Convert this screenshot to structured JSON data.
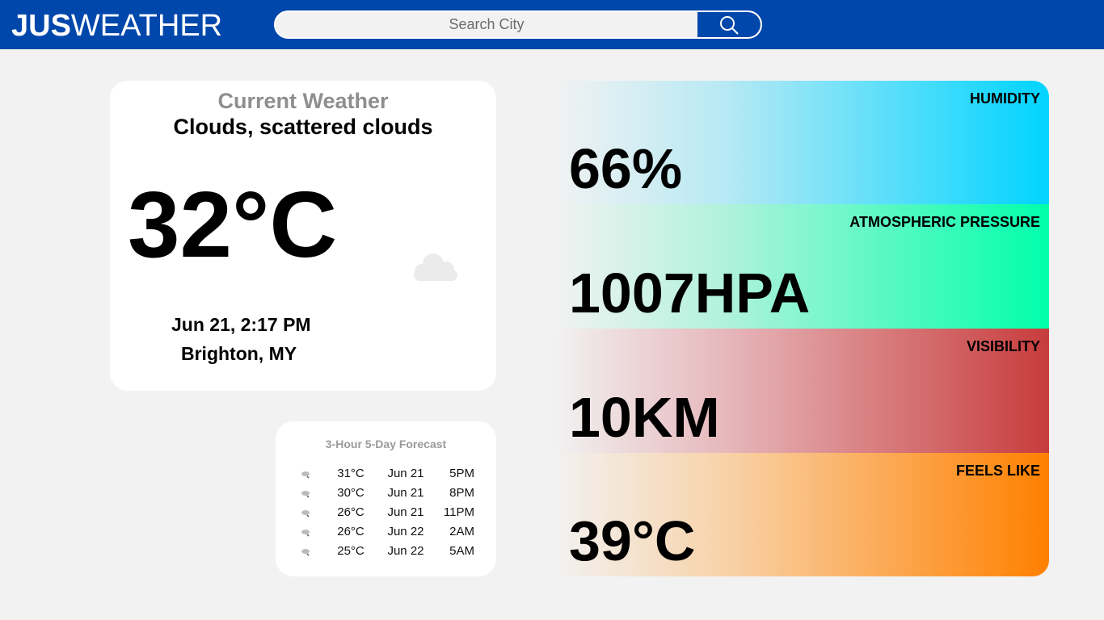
{
  "header": {
    "logo_bold": "JUS",
    "logo_regular": "WEATHER",
    "search_placeholder": "Search City",
    "search_icon": "search-icon"
  },
  "current": {
    "heading": "Current Weather",
    "description": "Clouds, scattered clouds",
    "temperature": "32°C",
    "icon": "cloud-icon",
    "datetime": "Jun 21, 2:17 PM",
    "location": "Brighton, MY"
  },
  "forecast": {
    "title": "3-Hour 5-Day Forecast",
    "rows": [
      {
        "icon": "cloud-rain-icon",
        "temp": "31°C",
        "date": "Jun 21",
        "hour": "5PM"
      },
      {
        "icon": "cloud-rain-icon",
        "temp": "30°C",
        "date": "Jun 21",
        "hour": "8PM"
      },
      {
        "icon": "cloud-rain-icon",
        "temp": "26°C",
        "date": "Jun 21",
        "hour": "11PM"
      },
      {
        "icon": "cloud-rain-icon",
        "temp": "26°C",
        "date": "Jun 22",
        "hour": "2AM"
      },
      {
        "icon": "cloud-rain-icon",
        "temp": "25°C",
        "date": "Jun 22",
        "hour": "5AM"
      }
    ]
  },
  "stats": {
    "humidity": {
      "label": "HUMIDITY",
      "value": "66%",
      "color": "#00d4ff"
    },
    "pressure": {
      "label": "ATMOSPHERIC PRESSURE",
      "value": "1007HPA",
      "color": "#00ffaa"
    },
    "visibility": {
      "label": "VISIBILITY",
      "value": "10KM",
      "color": "#c83c3c"
    },
    "feels_like": {
      "label": "FEELS LIKE",
      "value": "39°C",
      "color": "#ff8000"
    }
  },
  "colors": {
    "brand": "#0047ab",
    "background": "#f2f2f2"
  }
}
